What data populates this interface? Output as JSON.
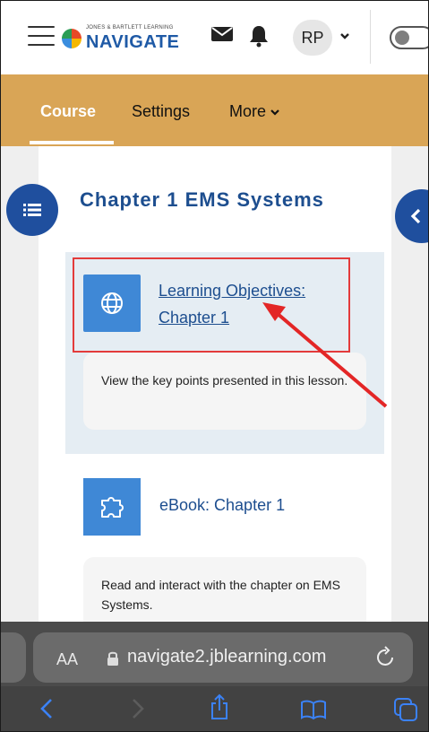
{
  "header": {
    "logo_small": "JONES & BARTLETT LEARNING",
    "logo_main": "NAVIGATE",
    "avatar_initials": "RP"
  },
  "tabs": [
    {
      "label": "Course",
      "active": true
    },
    {
      "label": "Settings"
    },
    {
      "label": "More"
    }
  ],
  "page": {
    "title": "Chapter 1 EMS Systems"
  },
  "activities": [
    {
      "icon": "globe-icon",
      "link": "Learning Objectives: Chapter 1",
      "description": "View the key points presented in this lesson."
    },
    {
      "icon": "puzzle-icon",
      "link": "eBook: Chapter 1",
      "description": "Read and interact with the chapter on EMS Systems."
    }
  ],
  "browser": {
    "text_size_label": "AA",
    "url": "navigate2.jblearning.com"
  },
  "colors": {
    "tab_bar": "#d9a556",
    "brand_blue": "#1d4e8f",
    "activity_icon": "#3f88d6",
    "highlight_red": "#e33b3b"
  }
}
